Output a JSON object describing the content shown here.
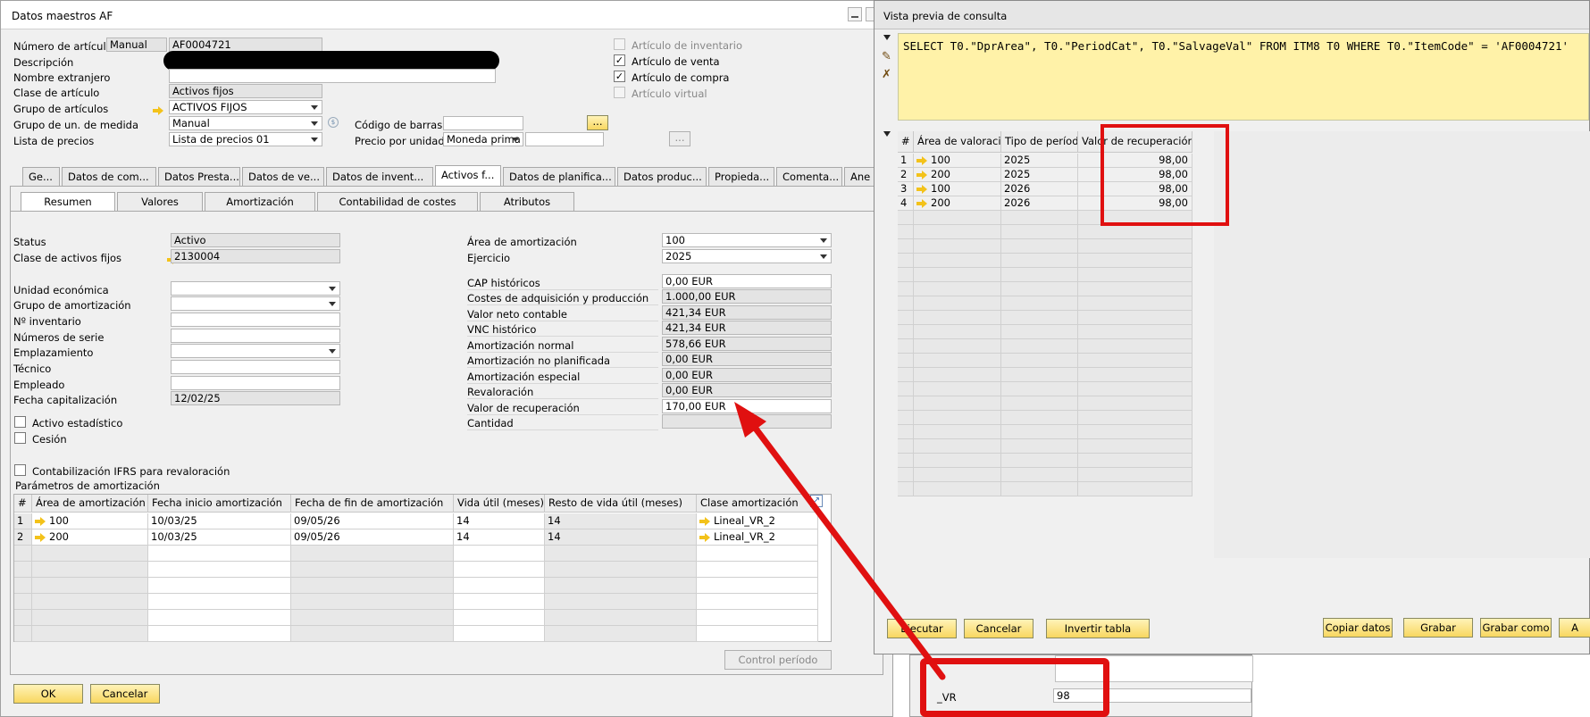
{
  "main_window": {
    "title": "Datos maestros AF",
    "header": {
      "item_number_label": "Número de artículo",
      "item_number_series": "Manual",
      "item_number": "AF0004721",
      "description_label": "Descripción",
      "foreign_name_label": "Nombre extranjero",
      "item_class_label": "Clase de artículo",
      "item_class": "Activos fijos",
      "item_group_label": "Grupo de artículos",
      "item_group": "ACTIVOS FIJOS",
      "uom_group_label": "Grupo de un. de medida",
      "uom_group": "Manual",
      "price_list_label": "Lista de precios",
      "price_list": "Lista de precios 01",
      "barcode_label": "Código de barras",
      "unit_price_label": "Precio por unidad",
      "unit_price_currency": "Moneda prima",
      "ellipsis": "...",
      "checkboxes": [
        {
          "label": "Artículo de inventario",
          "checked": false,
          "disabled": true
        },
        {
          "label": "Artículo de venta",
          "checked": true,
          "disabled": false
        },
        {
          "label": "Artículo de compra",
          "checked": true,
          "disabled": false
        },
        {
          "label": "Artículo virtual",
          "checked": false,
          "disabled": true
        }
      ],
      "check_mark": "✓"
    },
    "tabs": [
      "Ge...",
      "Datos de com...",
      "Datos Presta...",
      "Datos de ve...",
      "Datos de invent...",
      "Activos f...",
      "Datos de planifica...",
      "Datos produc...",
      "Propieda...",
      "Comenta...",
      "Ane"
    ],
    "subtabs": [
      "Resumen",
      "Valores",
      "Amortización",
      "Contabilidad de costes",
      "Atributos"
    ],
    "left_fields": {
      "status_label": "Status",
      "status": "Activo",
      "asset_class_label": "Clase de activos fijos",
      "asset_class": "2130004",
      "economic_unit_label": "Unidad económica",
      "depr_group_label": "Grupo de amortización",
      "inventory_no_label": "Nº inventario",
      "serial_no_label": "Números de serie",
      "location_label": "Emplazamiento",
      "technician_label": "Técnico",
      "employee_label": "Empleado",
      "cap_date_label": "Fecha capitalización",
      "cap_date": "12/02/25",
      "statistical_label": "Activo estadístico",
      "cession_label": "Cesión",
      "ifrs_label": "Contabilización IFRS para revaloración"
    },
    "right_fields": {
      "depr_area_label": "Área de amortización",
      "depr_area": "100",
      "fiscal_year_label": "Ejercicio",
      "fiscal_year": "2025",
      "values": [
        {
          "label": "CAP históricos",
          "value": "0,00 EUR",
          "gray": false
        },
        {
          "label": "Costes de adquisición y producción",
          "value": "1.000,00 EUR",
          "gray": true
        },
        {
          "label": "Valor neto contable",
          "value": "421,34 EUR",
          "gray": true
        },
        {
          "label": "VNC histórico",
          "value": "421,34 EUR",
          "gray": true
        },
        {
          "label": "Amortización normal",
          "value": "578,66 EUR",
          "gray": true
        },
        {
          "label": "Amortización no planificada",
          "value": "0,00 EUR",
          "gray": true
        },
        {
          "label": "Amortización especial",
          "value": "0,00 EUR",
          "gray": true
        },
        {
          "label": "Revaloración",
          "value": "0,00 EUR",
          "gray": true
        },
        {
          "label": "Valor de recuperación",
          "value": "170,00 EUR",
          "gray": false
        },
        {
          "label": "Cantidad",
          "value": "",
          "gray": true
        }
      ]
    },
    "depr_params": {
      "title": "Parámetros de amortización",
      "columns": [
        "#",
        "Área de amortización",
        "Fecha inicio amortización",
        "Fecha de fin de amortización",
        "Vida útil (meses)",
        "Resto de vida útil (meses)",
        "Clase amortización"
      ],
      "rows": [
        [
          "1",
          "100",
          "10/03/25",
          "09/05/26",
          "14",
          "14",
          "Lineal_VR_2"
        ],
        [
          "2",
          "200",
          "10/03/25",
          "09/05/26",
          "14",
          "14",
          "Lineal_VR_2"
        ]
      ]
    },
    "period_control": "Control período",
    "ok": "OK",
    "cancel": "Cancelar"
  },
  "query_window": {
    "title": "Vista previa de consulta",
    "sql": "SELECT T0.\"DprArea\", T0.\"PeriodCat\", T0.\"SalvageVal\" FROM ITM8 T0 WHERE T0.\"ItemCode\" = 'AF0004721'",
    "columns": [
      "#",
      "Área de valoración",
      "Tipo de período",
      "Valor de recuperación"
    ],
    "rows": [
      [
        "1",
        "100",
        "2025",
        "98,00"
      ],
      [
        "2",
        "200",
        "2025",
        "98,00"
      ],
      [
        "3",
        "100",
        "2026",
        "98,00"
      ],
      [
        "4",
        "200",
        "2026",
        "98,00"
      ]
    ],
    "buttons": {
      "execute": "Ejecutar",
      "cancel": "Cancelar",
      "invert": "Invertir tabla",
      "copy": "Copiar datos",
      "save": "Grabar",
      "save_as": "Grabar como",
      "more": "A"
    }
  },
  "behind_window": {
    "field_label": "_VR",
    "field_value": "98"
  },
  "colors": {
    "highlight_red": "#e01010",
    "sql_bg": "#fff2a8",
    "button_yellow": "#f8d760"
  }
}
